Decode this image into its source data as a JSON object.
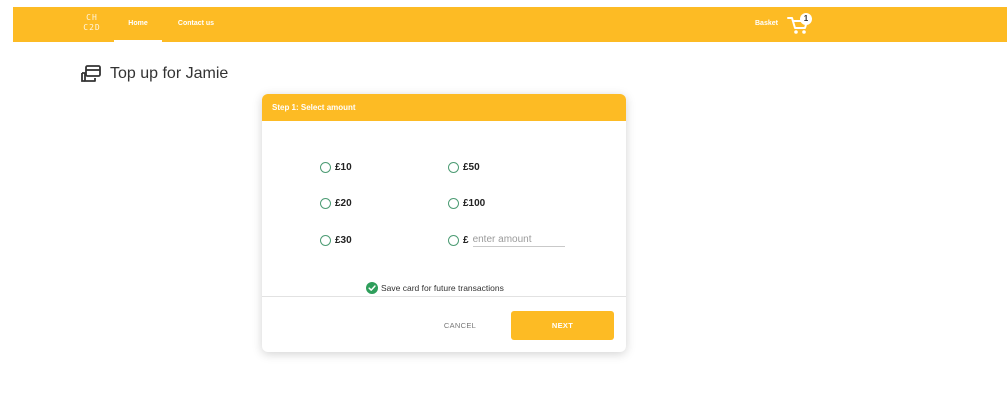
{
  "nav": {
    "logo": "CH\nC2D",
    "links": [
      {
        "label": "Home",
        "active": true
      },
      {
        "label": "Contact us",
        "active": false
      }
    ],
    "basket_label": "Basket",
    "basket_count": "1",
    "cart_icon": "shopping-cart-icon"
  },
  "page": {
    "title": "Top up for Jamie",
    "title_icon": "wallet-cards-icon"
  },
  "card": {
    "header": "Step 1: Select amount",
    "options": [
      "£10",
      "£50",
      "£20",
      "£100",
      "£30"
    ],
    "custom_prefix": "£",
    "custom_placeholder": "enter amount",
    "custom_value": "",
    "save_card_label": "Save card for future transactions",
    "save_card_checked": true,
    "cancel_label": "CANCEL",
    "next_label": "NEXT"
  },
  "colors": {
    "brand": "#fdbb24",
    "radio": "#4d9c74",
    "check": "#2e9e5b"
  }
}
